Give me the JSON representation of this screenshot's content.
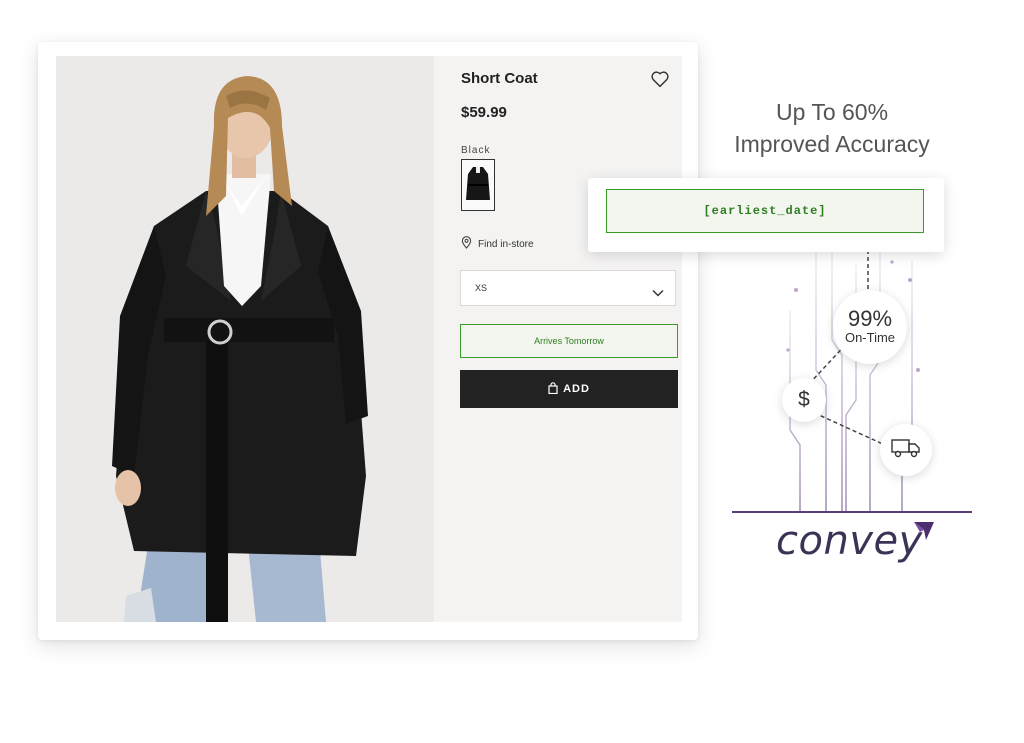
{
  "product": {
    "title": "Short Coat",
    "price": "$59.99",
    "color_label": "Black",
    "find_in_store": "Find in-store",
    "size": {
      "selected": "XS"
    },
    "delivery_message": "Arrives Tomorrow",
    "add_button": "ADD"
  },
  "promo": {
    "tagline_line1": "Up To 60%",
    "tagline_line2": "Improved Accuracy",
    "popover_field": "[earliest_date]",
    "on_time_percent": "99%",
    "on_time_label": "On-Time",
    "dollar_symbol": "$",
    "brand": "convey"
  },
  "icons": [
    "heart-icon",
    "location-pin-icon",
    "chevron-down-icon",
    "shopping-bag-icon",
    "truck-icon"
  ],
  "colors": {
    "accent_green": "#3a9a2a",
    "brand_purple": "#5a3f78",
    "button_dark": "#222222"
  }
}
